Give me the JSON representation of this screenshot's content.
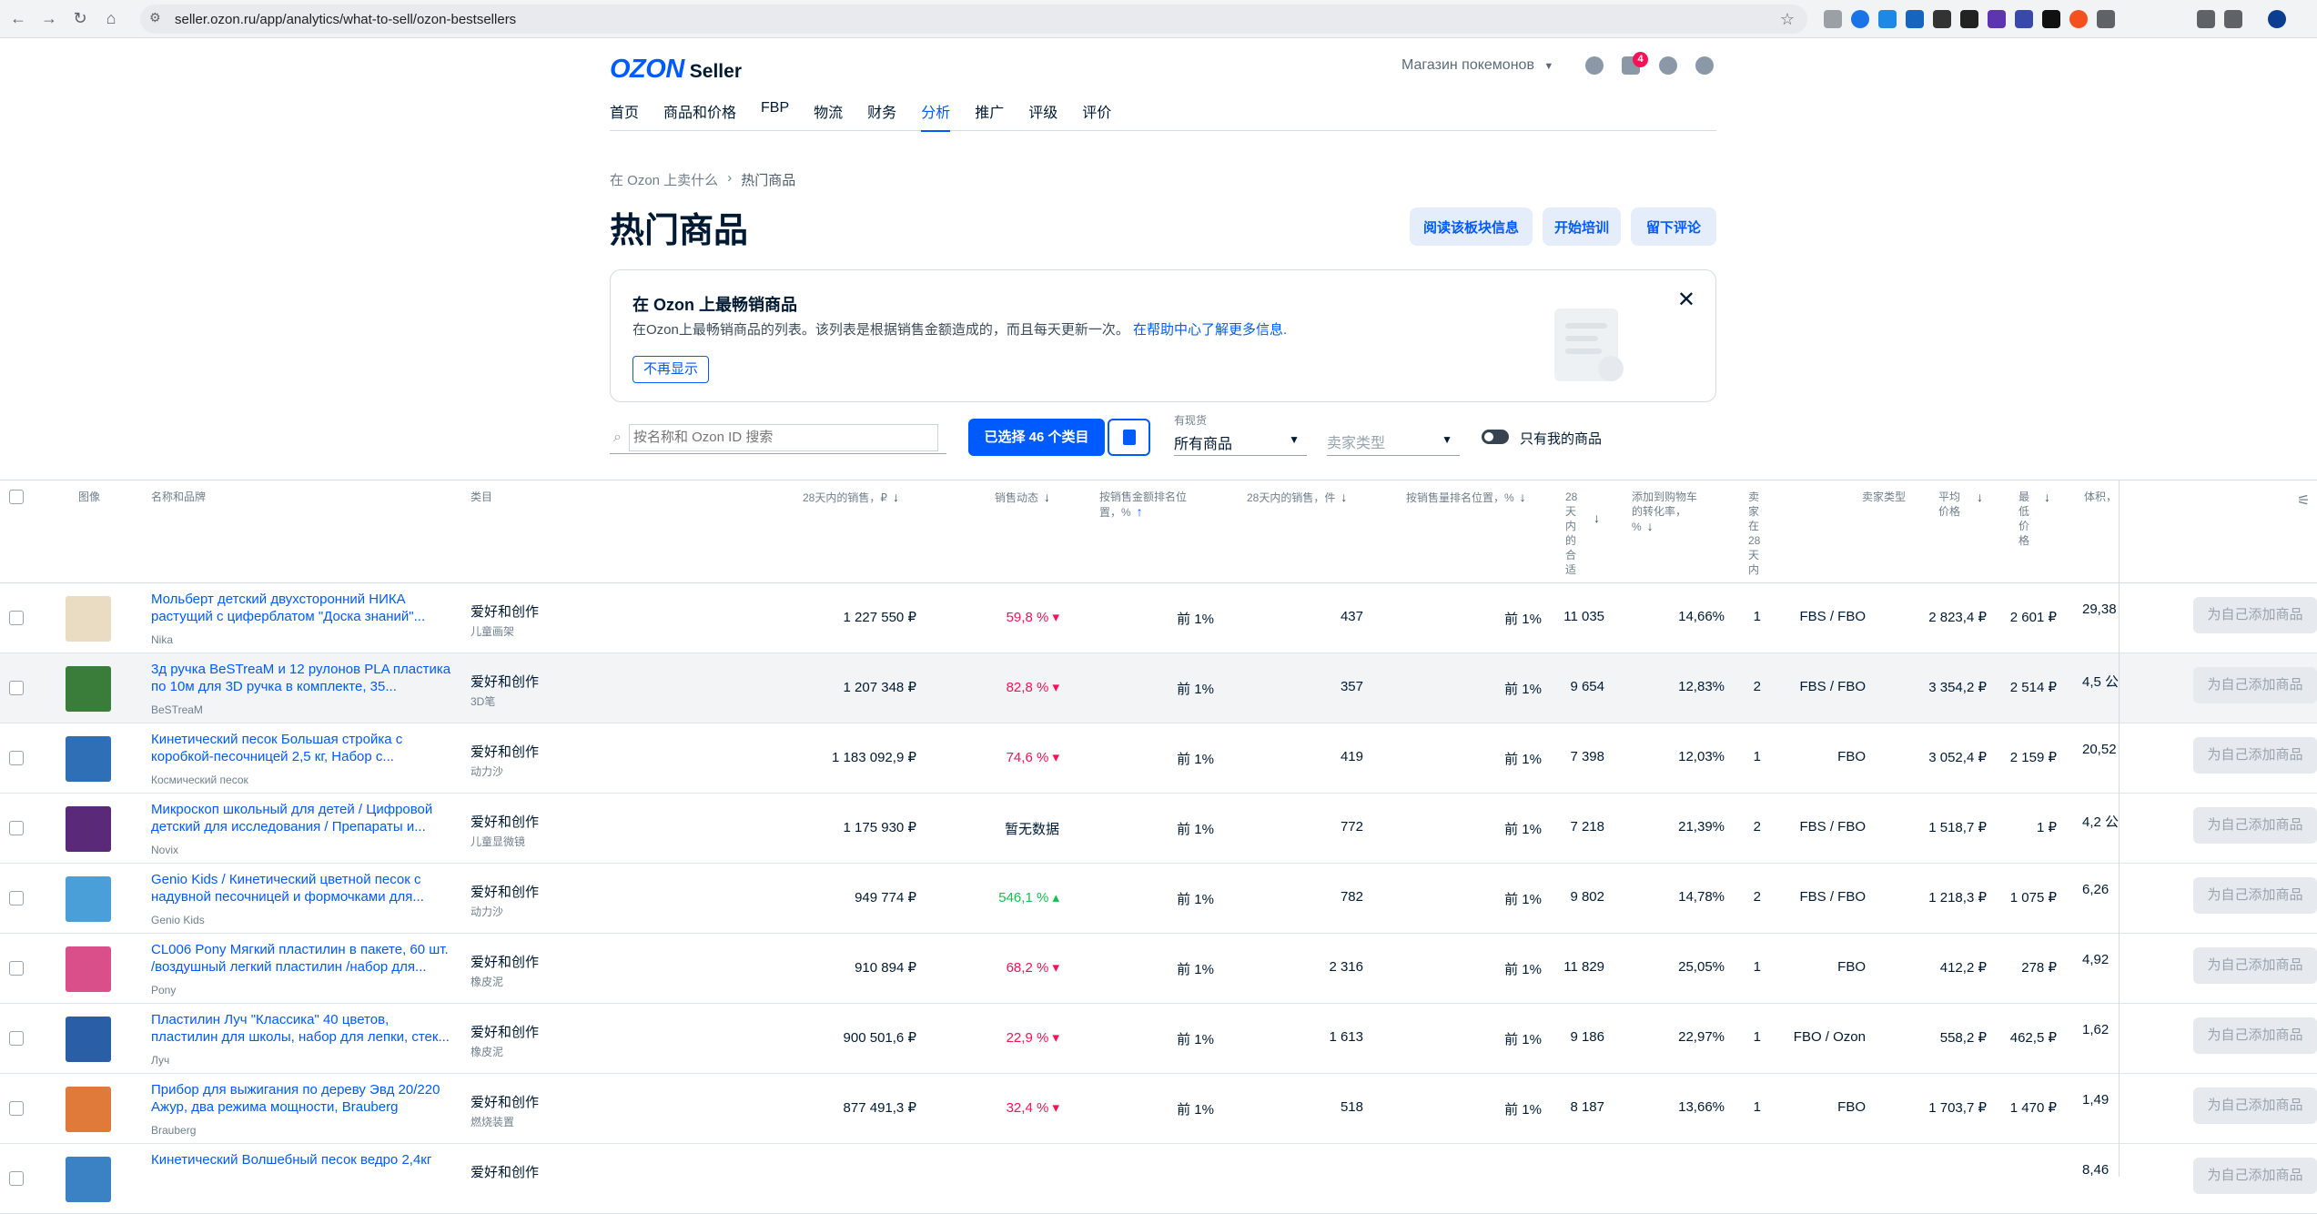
{
  "browser": {
    "url": "seller.ozon.ru/app/analytics/what-to-sell/ozon-bestsellers"
  },
  "header": {
    "logo_text": "OZON",
    "logo_sub": "Seller",
    "shop_name": "Магазин покемонов",
    "notification_count": "4",
    "nav": [
      "首页",
      "商品和价格",
      "FBP",
      "物流",
      "财务",
      "分析",
      "推广",
      "评级",
      "评价"
    ],
    "active_nav": "分析"
  },
  "breadcrumb": {
    "parent": "在 Ozon 上卖什么",
    "current": "热门商品"
  },
  "page": {
    "title": "热门商品",
    "buttons": {
      "read": "阅读该板块信息",
      "training": "开始培训",
      "review": "留下评论"
    }
  },
  "banner": {
    "title": "在 Ozon 上最畅销商品",
    "desc": "在Ozon上最畅销商品的列表。该列表是根据销售金额造成的，而且每天更新一次。",
    "link": "在帮助中心了解更多信息.",
    "hide_label": "不再显示"
  },
  "filters": {
    "search_placeholder": "按名称和 Ozon ID 搜索",
    "selected_label": "已选择 46 个类目",
    "stock_label": "有现货",
    "stock_value": "所有商品",
    "seller_type_placeholder": "卖家类型",
    "only_mine_label": "只有我的商品"
  },
  "table": {
    "headers": {
      "image": "图像",
      "name": "名称和品牌",
      "category": "类目",
      "sales_28": "28天内的销售，₽",
      "dynamics": "销售动态",
      "rank_amount": "按销售金额排名位置，%",
      "sales_qty": "28天内的销售，件",
      "rank_qty": "按销售量排名位置，%",
      "days_28": "28天内的合适",
      "conversion": "添加到购物车的转化率，%",
      "sellers": "卖家在28天内",
      "seller_type": "卖家类型",
      "avg_price": "平均价格",
      "min_price": "最低价格",
      "volume": "体积，"
    },
    "add_label": "为自己添加商品",
    "rows": [
      {
        "name": "Мольберт детский двухсторонний НИКА растущий с циферблатом \"Доска знаний\"...",
        "brand": "Nika",
        "cat": "爱好和创作",
        "sub": "儿童画架",
        "sales": "1 227 550 ₽",
        "dyn": "59,8 %",
        "dyn_dir": "down",
        "rank": "前 1%",
        "qty": "437",
        "rank_qty": "前 1%",
        "n28": "11 035",
        "conv": "14,66%",
        "sellers": "1",
        "stype": "FBS / FBO",
        "avg": "2 823,4 ₽",
        "min": "2 601 ₽",
        "vol": "29,38",
        "thumb": "#e9dcc2"
      },
      {
        "name": "3д ручка BeSTreaM и 12 рулонов PLA пластика по 10м для 3D ручка в комплекте, 35...",
        "brand": "BeSTreaM",
        "cat": "爱好和创作",
        "sub": "3D笔",
        "sales": "1 207 348 ₽",
        "dyn": "82,8 %",
        "dyn_dir": "down",
        "rank": "前 1%",
        "qty": "357",
        "rank_qty": "前 1%",
        "n28": "9 654",
        "conv": "12,83%",
        "sellers": "2",
        "stype": "FBS / FBO",
        "avg": "3 354,2 ₽",
        "min": "2 514 ₽",
        "vol": "4,5 公",
        "thumb": "#3a7d3a"
      },
      {
        "name": "Кинетический песок Большая стройка с коробкой-песочницей 2,5 кг, Набор с...",
        "brand": "Космический песок",
        "cat": "爱好和创作",
        "sub": "动力沙",
        "sales": "1 183 092,9 ₽",
        "dyn": "74,6 %",
        "dyn_dir": "down",
        "rank": "前 1%",
        "qty": "419",
        "rank_qty": "前 1%",
        "n28": "7 398",
        "conv": "12,03%",
        "sellers": "1",
        "stype": "FBO",
        "avg": "3 052,4 ₽",
        "min": "2 159 ₽",
        "vol": "20,52",
        "thumb": "#2f6fb5"
      },
      {
        "name": "Микроскоп школьный для детей / Цифровой детский для исследования / Препараты и...",
        "brand": "Novix",
        "cat": "爱好和创作",
        "sub": "儿童显微镜",
        "sales": "1 175 930 ₽",
        "dyn": "暂无数据",
        "dyn_dir": "none",
        "rank": "前 1%",
        "qty": "772",
        "rank_qty": "前 1%",
        "n28": "7 218",
        "conv": "21,39%",
        "sellers": "2",
        "stype": "FBS / FBO",
        "avg": "1 518,7 ₽",
        "min": "1 ₽",
        "vol": "4,2 公",
        "thumb": "#5a2a78"
      },
      {
        "name": "Genio Kids / Кинетический цветной песок с надувной песочницей и формочками для...",
        "brand": "Genio Kids",
        "cat": "爱好和创作",
        "sub": "动力沙",
        "sales": "949 774 ₽",
        "dyn": "546,1 %",
        "dyn_dir": "up",
        "rank": "前 1%",
        "qty": "782",
        "rank_qty": "前 1%",
        "n28": "9 802",
        "conv": "14,78%",
        "sellers": "2",
        "stype": "FBS / FBO",
        "avg": "1 218,3 ₽",
        "min": "1 075 ₽",
        "vol": "6,26",
        "thumb": "#4a9fd8"
      },
      {
        "name": "CL006 Pony Мягкий пластилин в пакете, 60 шт. /воздушный легкий пластилин /набор для...",
        "brand": "Pony",
        "cat": "爱好和创作",
        "sub": "橡皮泥",
        "sales": "910 894 ₽",
        "dyn": "68,2 %",
        "dyn_dir": "down",
        "rank": "前 1%",
        "qty": "2 316",
        "rank_qty": "前 1%",
        "n28": "11 829",
        "conv": "25,05%",
        "sellers": "1",
        "stype": "FBO",
        "avg": "412,2 ₽",
        "min": "278 ₽",
        "vol": "4,92",
        "thumb": "#d94f8a"
      },
      {
        "name": "Пластилин Луч \"Классика\" 40 цветов, пластилин для школы, набор для лепки, стек...",
        "brand": "Луч",
        "cat": "爱好和创作",
        "sub": "橡皮泥",
        "sales": "900 501,6 ₽",
        "dyn": "22,9 %",
        "dyn_dir": "down",
        "rank": "前 1%",
        "qty": "1 613",
        "rank_qty": "前 1%",
        "n28": "9 186",
        "conv": "22,97%",
        "sellers": "1",
        "stype": "FBO / Ozon",
        "avg": "558,2 ₽",
        "min": "462,5 ₽",
        "vol": "1,62",
        "thumb": "#2a5fa8"
      },
      {
        "name": "Прибор для выжигания по дереву Эвд 20/220 Ажур, два режима мощности, Brauberg",
        "brand": "Brauberg",
        "cat": "爱好和创作",
        "sub": "燃烧装置",
        "sales": "877 491,3 ₽",
        "dyn": "32,4 %",
        "dyn_dir": "down",
        "rank": "前 1%",
        "qty": "518",
        "rank_qty": "前 1%",
        "n28": "8 187",
        "conv": "13,66%",
        "sellers": "1",
        "stype": "FBO",
        "avg": "1 703,7 ₽",
        "min": "1 470 ₽",
        "vol": "1,49",
        "thumb": "#e07a3a"
      },
      {
        "name": "Кинетический Волшебный песок ведро 2,4кг",
        "brand": "",
        "cat": "爱好和创作",
        "sub": "",
        "sales": "",
        "dyn": "",
        "dyn_dir": "none",
        "rank": "",
        "qty": "",
        "rank_qty": "",
        "n28": "",
        "conv": "",
        "sellers": "",
        "stype": "",
        "avg": "",
        "min": "",
        "vol": "8,46",
        "thumb": "#3b82c4"
      }
    ]
  },
  "colors": {
    "accent": "#005bff",
    "negative": "#f91155",
    "positive": "#10c44c"
  }
}
